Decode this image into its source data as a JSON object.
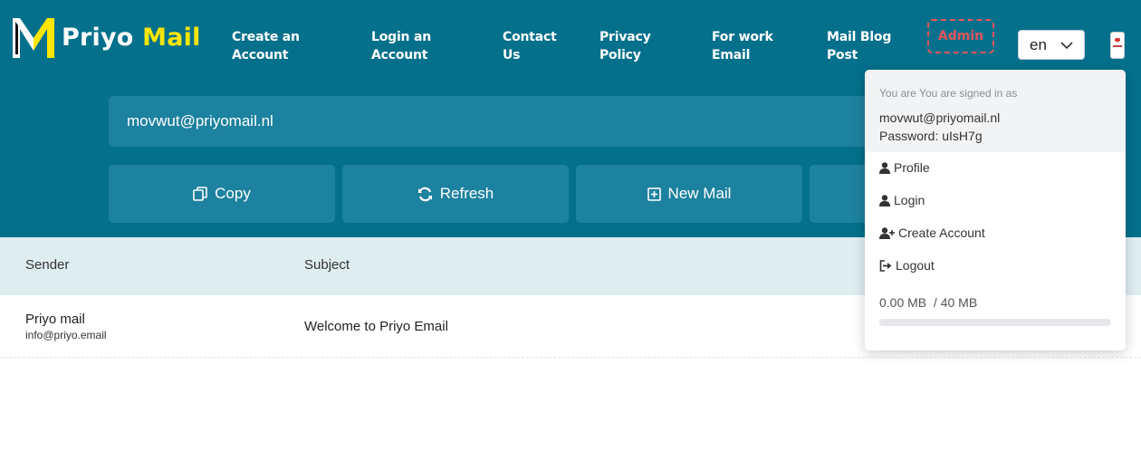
{
  "brand": {
    "word1": "Priyo",
    "word2": "Mail"
  },
  "nav": [
    {
      "line1": "Create an",
      "line2": "Account"
    },
    {
      "line1": "Login an",
      "line2": "Account"
    },
    {
      "line1": "Contact",
      "line2": "Us"
    },
    {
      "line1": "Privacy",
      "line2": "Policy"
    },
    {
      "line1": "For work",
      "line2": "Email"
    },
    {
      "line1": "Mail Blog",
      "line2": "Post"
    }
  ],
  "admin_label": "Admin",
  "language": {
    "selected": "en"
  },
  "email_address": "movwut@priyomail.nl",
  "actions": {
    "copy": "Copy",
    "refresh": "Refresh",
    "new_mail": "New Mail"
  },
  "table": {
    "headers": {
      "sender": "Sender",
      "subject": "Subject"
    },
    "rows": [
      {
        "sender_name": "Priyo mail",
        "sender_email": "info@priyo.email",
        "subject": "Welcome to Priyo Email"
      }
    ]
  },
  "account_menu": {
    "signed_in_text": "You are You are signed in as",
    "email": "movwut@priyomail.nl",
    "password": "Password: uIsH7g",
    "items": {
      "profile": "Profile",
      "login": "Login",
      "create_account": "Create Account",
      "logout": "Logout"
    },
    "storage": {
      "used": "0.00 MB",
      "separator": "/",
      "total": "40 MB",
      "used_fraction": 0
    }
  },
  "colors": {
    "header_bg": "#04708c",
    "accent": "#1d829f",
    "brand_yellow": "#ffe600",
    "admin_red": "#e0565b",
    "table_head_bg": "#deedf0"
  },
  "icons": [
    "logo-m-icon",
    "chevron-down-icon",
    "copy-icon",
    "refresh-icon",
    "plus-square-icon",
    "user-icon",
    "user-plus-icon",
    "sign-out-icon"
  ]
}
